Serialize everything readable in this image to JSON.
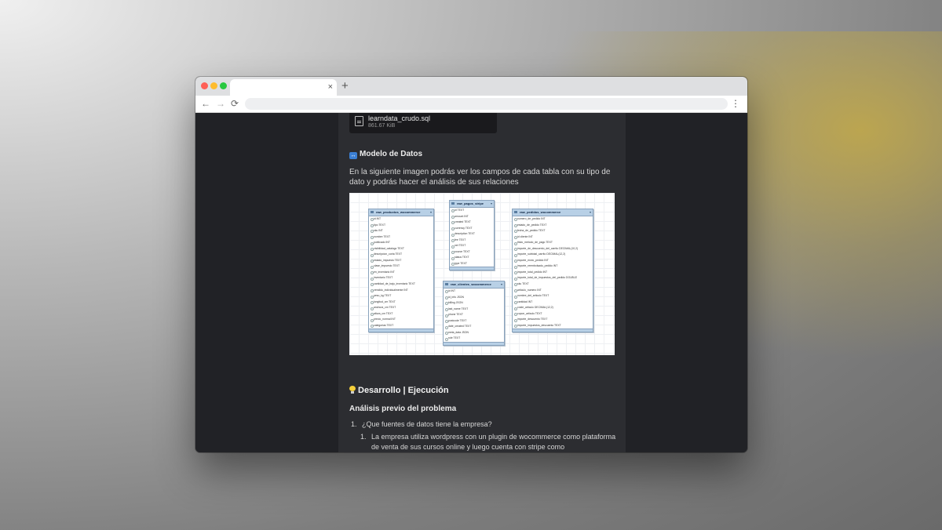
{
  "browser": {
    "close_tab": "×",
    "new_tab": "+",
    "back": "←",
    "forward": "→",
    "reload": "⟳",
    "menu": "⋮"
  },
  "file": {
    "name": "learndata_crudo.sql",
    "size": "861.67 KiB"
  },
  "model_section": {
    "heading": "Modelo de Datos",
    "icon": "left-right-arrow-icon",
    "text": "En la siguiente imagen podrás ver los campos de cada tabla con su tipo de dato y podrás hacer el análisis de sus relaciones"
  },
  "diagram": {
    "tables": [
      {
        "name": "raw_productos_wocommerce",
        "fields": [
          "id INT",
          "tipo TEXT",
          "sku INT",
          "nombre TEXT",
          "publicado INT",
          "visibilidad_catalogo TEXT",
          "descripcion_corta TEXT",
          "estado_impuesto TEXT",
          "clase_impuesto TEXT",
          "en_inventario INT",
          "inventario TEXT",
          "cantidad_de_bajo_inventario TEXT",
          "vendido_individualmente INT",
          "peso_kg TEXT",
          "longitud_cm TEXT",
          "anchura_cm TEXT",
          "altura_cm TEXT",
          "precio_normal INT",
          "categorias TEXT"
        ]
      },
      {
        "name": "raw_pagos_stripe",
        "fields": [
          "id TEXT",
          "amount INT",
          "created TEXT",
          "currency TEXT",
          "description TEXT",
          "fee TEXT",
          "net TEXT",
          "source TEXT",
          "status TEXT",
          "type TEXT"
        ]
      },
      {
        "name": "raw_clientes_wocommerce",
        "fields": [
          "id INT",
          "id_info JSON",
          "billing JSON",
          "last_name TEXT",
          "phone TEXT",
          "postcode TEXT",
          "date_created TEXT",
          "meta_data JSON",
          "role TEXT"
        ]
      },
      {
        "name": "raw_pedidos_wocommerce",
        "fields": [
          "numero_de_pedido INT",
          "estado_de_pedido TEXT",
          "fecha_de_pedido TEXT",
          "id cliente INT",
          "titulo_metodo_de_pago TEXT",
          "importe_de_descuento_del_carrito DECIMAL(10,2)",
          "importe_subtotal_carrito DECIMAL(12,2)",
          "importe_envio_pedido INT",
          "importe_reembolsado_pedido INT",
          "importe_total_pedido INT",
          "importe_total_de_impuestos_del_pedido DOUBLE",
          "sku TEXT",
          "articulo_numero INT",
          "nombre_del_articulo TEXT",
          "cantidad INT",
          "coste_articulo DECIMAL(12,2)",
          "cupon_articulo TEXT",
          "importe_descuento TEXT",
          "importe_impuestos_descuento TEXT"
        ]
      }
    ]
  },
  "dev_section": {
    "heading": "Desarrollo | Ejecución",
    "icon": "light-bulb-icon",
    "subheading": "Análisis previo del problema",
    "q1_num": "1.",
    "q1": "¿Que fuentes de datos tiene la empresa?",
    "a1_num": "1.",
    "a1": "La empresa utiliza wordpress con un plugin de wocommerce como plataforma de venta de sus cursos online y luego cuenta con stripe como"
  },
  "colors": {
    "page_bg": "#212226",
    "content_bg": "#2c2d31",
    "table_header": "#b8d0e6"
  }
}
